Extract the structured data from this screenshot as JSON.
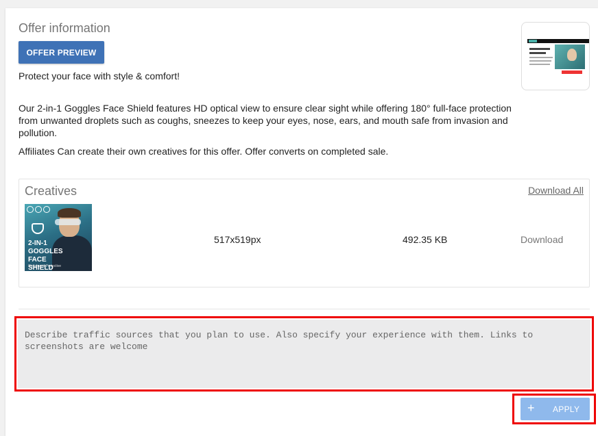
{
  "offer": {
    "title": "Offer information",
    "preview_button": "OFFER PREVIEW",
    "tagline": "Protect your face with style & comfort!",
    "description": "Our 2-in-1 Goggles Face Shield features HD optical view to ensure clear sight while offering 180° full-face protection from unwanted droplets such as coughs, sneezes to keep your eyes, nose, ears, and mouth safe from invasion and pollution.",
    "note": "Affiliates Can create their own creatives for this offer. Offer converts on completed sale."
  },
  "creatives": {
    "title": "Creatives",
    "download_all": "Download All",
    "items": [
      {
        "image_text": "2-IN-1 GOGGLES FACE SHIELD",
        "image_subtext": "Stylish and Protective",
        "dimensions": "517x519px",
        "size": "492.35 KB",
        "download": "Download"
      }
    ]
  },
  "apply_form": {
    "traffic_placeholder": "Describe traffic sources that you plan to use. Also specify your experience with them. Links to screenshots are welcome",
    "apply_label": "APPLY",
    "apply_icon": "plus-icon"
  },
  "colors": {
    "primary": "#3f72b6",
    "apply_disabled": "#8fb9ec",
    "highlight": "#ee0000"
  }
}
